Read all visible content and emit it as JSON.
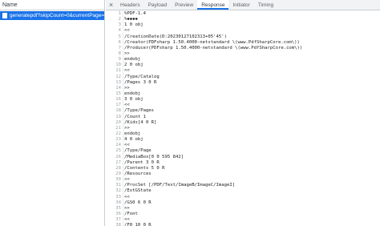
{
  "left_panel": {
    "header": "Name",
    "request": {
      "name": "generatepdf?skipCount=0&currentPage=0&..."
    }
  },
  "tabs": {
    "close": "×",
    "items": [
      "Headers",
      "Payload",
      "Preview",
      "Response",
      "Initiator",
      "Timing"
    ],
    "active": "Response"
  },
  "response": {
    "lines": [
      "%PDF-1.4",
      "%◆◆◆◆",
      "1 0 obj",
      "<<",
      "/CreationDate(D:20230127102313+05'45')",
      "/Creator(PDFsharp 1.50.4000-netstandard \\(www.PdfSharpCore.com\\))",
      "/Producer(PDFsharp 1.50.4000-netstandard \\(www.PdfSharpCore.com\\))",
      ">>",
      "endobj",
      "2 0 obj",
      "<<",
      "/Type/Catalog",
      "/Pages 3 0 R",
      ">>",
      "endobj",
      "3 0 obj",
      "<<",
      "/Type/Pages",
      "/Count 1",
      "/Kids[4 0 R]",
      ">>",
      "endobj",
      "4 0 obj",
      "<<",
      "/Type/Page",
      "/MediaBox[0 0 595 842]",
      "/Parent 3 0 R",
      "/Contents 5 0 R",
      "/Resources",
      "<<",
      "/ProcSet [/PDF/Text/ImageB/ImageC/ImageI]",
      "/ExtGState",
      "<<",
      "/GS0 6 0 R",
      ">>",
      "/Font",
      "<<",
      "/F0 10 0 R"
    ]
  }
}
